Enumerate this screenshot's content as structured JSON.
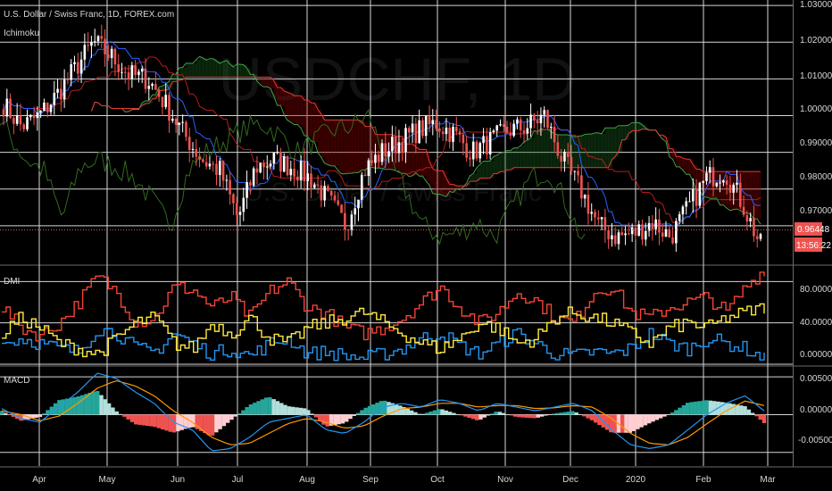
{
  "header": {
    "symbol_title": "U.S. Dollar / Swiss Franc, 1D, FOREX.com",
    "indicator_main": "Ichimoku",
    "indicator_dmi": "DMI",
    "indicator_macd": "MACD"
  },
  "watermark": {
    "ticker": "USDCHF, 1D",
    "name": "U.S. Dollar / Swiss Franc"
  },
  "price_axis": {
    "ticks": [
      "1.03000",
      "1.02000",
      "1.01000",
      "1.00000",
      "0.99000",
      "0.98000",
      "0.97000"
    ],
    "last_price": "0.96448",
    "countdown": "13:56:22"
  },
  "dmi_axis": {
    "ticks": [
      "80.00000",
      "40.00000",
      "0.00000"
    ]
  },
  "macd_axis": {
    "ticks": [
      "0.00500",
      "0.00000",
      "-0.00500"
    ]
  },
  "time_axis": {
    "labels": [
      "Apr",
      "May",
      "Jun",
      "Jul",
      "Aug",
      "Sep",
      "Oct",
      "Nov",
      "Dec",
      "2020",
      "Feb",
      "Mar"
    ]
  },
  "colors": {
    "up": "#ffffff",
    "down": "#ef5350",
    "tenkan": "#2962ff",
    "kijun": "#b71c1c",
    "chikou": "#33691e",
    "span_a": "#43a047",
    "span_b": "#e53935",
    "plus_di": "#2196f3",
    "minus_di": "#ffeb3b",
    "adx": "#f44336",
    "macd": "#2196f3",
    "signal": "#ff9800",
    "hist_up_strong": "#26a69a",
    "hist_up_weak": "#b2dfdb",
    "hist_down_strong": "#ef5350",
    "hist_down_weak": "#ffcdd2"
  },
  "chart_data": [
    {
      "type": "candlestick",
      "title": "U.S. Dollar / Swiss Franc, 1D, FOREX.com",
      "ylim": [
        0.9595,
        1.0315
      ],
      "anchor_closes": [
        [
          "Mar",
          1.003
        ],
        [
          "Apr",
          0.997
        ],
        [
          "Apr",
          1.0
        ],
        [
          "Apr",
          1.006
        ],
        [
          "Apr",
          1.013
        ],
        [
          "May",
          1.02
        ],
        [
          "May",
          1.016
        ],
        [
          "May",
          1.011
        ],
        [
          "May",
          1.01
        ],
        [
          "May",
          1.003
        ],
        [
          "Jun",
          0.995
        ],
        [
          "Jun",
          0.988
        ],
        [
          "Jun",
          0.985
        ],
        [
          "Jul",
          0.972
        ],
        [
          "Jul",
          0.986
        ],
        [
          "Jul",
          0.988
        ],
        [
          "Jul",
          0.986
        ],
        [
          "Aug",
          0.983
        ],
        [
          "Aug",
          0.977
        ],
        [
          "Aug",
          0.97
        ],
        [
          "Aug",
          0.985
        ],
        [
          "Sep",
          0.99
        ],
        [
          "Sep",
          0.993
        ],
        [
          "Sep",
          0.996
        ],
        [
          "Oct",
          0.998
        ],
        [
          "Oct",
          0.995
        ],
        [
          "Oct",
          0.99
        ],
        [
          "Nov",
          0.993
        ],
        [
          "Nov",
          0.996
        ],
        [
          "Nov",
          0.997
        ],
        [
          "Dec",
          1.0
        ],
        [
          "Dec",
          0.988
        ],
        [
          "Dec",
          0.98
        ],
        [
          "2020",
          0.97
        ],
        [
          "2020",
          0.967
        ],
        [
          "2020",
          0.968
        ],
        [
          "2020",
          0.971
        ],
        [
          "Feb",
          0.967
        ],
        [
          "Feb",
          0.975
        ],
        [
          "Feb",
          0.983
        ],
        [
          "Feb",
          0.985
        ],
        [
          "Mar",
          0.976
        ],
        [
          "Mar",
          0.9645
        ]
      ],
      "ichimoku": {
        "cloud_top_Apr_Jul": 1.003,
        "cloud_bottom_Apr_Jul": 0.994,
        "cloud_top_Aug_Oct": 0.997,
        "cloud_bottom_Aug_Oct": 0.987,
        "cloud_top_Dec_Mar": 0.9815,
        "cloud_bottom_Dec_Mar": 0.9705
      }
    },
    {
      "type": "line",
      "title": "DMI",
      "ylim": [
        0,
        95
      ],
      "series": [
        {
          "values": [
            55,
            35,
            28,
            40,
            60,
            85,
            70,
            40,
            45,
            75,
            72,
            55,
            65,
            45,
            70,
            80,
            55,
            50,
            35,
            30,
            35,
            45,
            60,
            75,
            55,
            40,
            50,
            70,
            62,
            45,
            40,
            70,
            75,
            50,
            45,
            55,
            60,
            65,
            50,
            75,
            92
          ]
        },
        {
          "values": [
            20,
            25,
            20,
            15,
            12,
            35,
            30,
            15,
            12,
            30,
            20,
            10,
            15,
            8,
            20,
            25,
            10,
            12,
            8,
            6,
            10,
            15,
            25,
            30,
            18,
            10,
            20,
            30,
            20,
            10,
            8,
            12,
            10,
            15,
            30,
            20,
            15,
            25,
            20,
            15,
            5
          ]
        },
        {
          "values": [
            30,
            45,
            35,
            20,
            15,
            10,
            25,
            40,
            45,
            20,
            15,
            40,
            30,
            45,
            25,
            20,
            35,
            40,
            45,
            50,
            40,
            30,
            20,
            15,
            25,
            40,
            35,
            20,
            25,
            45,
            50,
            45,
            40,
            30,
            20,
            35,
            40,
            35,
            45,
            50,
            55
          ]
        }
      ]
    },
    {
      "type": "line",
      "title": "MACD",
      "ylim": [
        -0.0068,
        0.0062
      ],
      "series": [
        {
          "values": [
            0.0008,
            -0.0005,
            -0.001,
            0.001,
            0.003,
            0.0055,
            0.0048,
            0.003,
            0.0015,
            -0.001,
            -0.002,
            -0.0048,
            -0.0045,
            -0.003,
            -0.001,
            -0.0005,
            0.0,
            -0.002,
            -0.0025,
            -0.001,
            0.001,
            0.0015,
            0.001,
            0.002,
            0.0015,
            0.0005,
            0.0015,
            0.001,
            0.0005,
            0.001,
            0.0015,
            0.0005,
            -0.002,
            -0.004,
            -0.0045,
            -0.004,
            -0.002,
            0.0,
            0.0015,
            0.0025,
            0.0005
          ]
        },
        {
          "values": [
            0.0005,
            0.0,
            -0.0008,
            -0.0002,
            0.0015,
            0.0035,
            0.0045,
            0.0038,
            0.0025,
            0.0005,
            -0.001,
            -0.003,
            -0.004,
            -0.0038,
            -0.0025,
            -0.0012,
            -0.0005,
            -0.001,
            -0.0018,
            -0.0015,
            -0.0002,
            0.0008,
            0.001,
            0.0015,
            0.0015,
            0.001,
            0.0012,
            0.0012,
            0.0008,
            0.0009,
            0.0012,
            0.001,
            -0.0005,
            -0.0025,
            -0.0038,
            -0.004,
            -0.003,
            -0.0012,
            0.0005,
            0.0018,
            0.0012
          ]
        }
      ]
    }
  ]
}
